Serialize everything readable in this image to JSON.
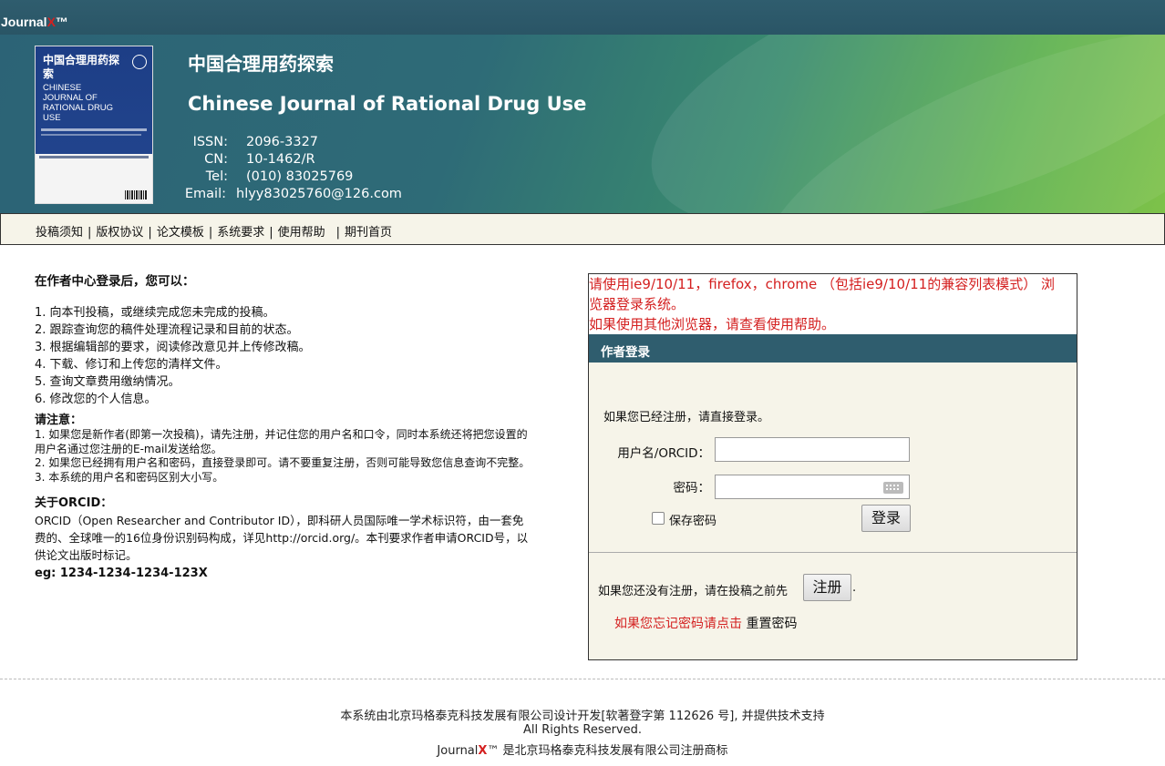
{
  "brand": {
    "prefix": "Journal",
    "x": "X",
    "tm": "™"
  },
  "journal": {
    "title_cn": "中国合理用药探索",
    "title_en": "Chinese Journal of Rational Drug Use",
    "cover": {
      "cn": "中国合理用药探索",
      "en": "CHINESE JOURNAL OF RATIONAL DRUG USE"
    },
    "info": [
      {
        "key": "ISSN:",
        "value": "2096-3327"
      },
      {
        "key": "CN:",
        "value": "10-1462/R"
      },
      {
        "key": "Tel:",
        "value": "(010) 83025769"
      },
      {
        "key": "Email:",
        "value": "hlyy83025760@126.com"
      }
    ]
  },
  "nav": [
    "投稿须知",
    "版权协议",
    "论文模板",
    "系统要求",
    "使用帮助",
    "期刊首页"
  ],
  "left": {
    "heading": "在作者中心登录后，您可以：",
    "items": [
      "1. 向本刊投稿，或继续完成您未完成的投稿。",
      "2. 跟踪查询您的稿件处理流程记录和目前的状态。",
      "3. 根据编辑部的要求，阅读修改意见并上传修改稿。",
      "4. 下载、修订和上传您的清样文件。",
      "5. 查询文章费用缴纳情况。",
      "6. 修改您的个人信息。"
    ],
    "note_title": "请注意：",
    "notes": [
      "1. 如果您是新作者(即第一次投稿)，请先注册，并记住您的用户名和口令，同时本系统还将把您设置的用户名通过您注册的E-mail发送给您。",
      "2. 如果您已经拥有用户名和密码，直接登录即可。请不要重复注册，否则可能导致您信息查询不完整。",
      "3. 本系统的用户名和密码区别大小写。"
    ],
    "orcid_title": "关于ORCID：",
    "orcid_text": "ORCID（Open Researcher and Contributor ID），即科研人员国际唯一学术标识符，由一套免费的、全球唯一的16位身份识别码构成，详见http://orcid.org/。本刊要求作者申请ORCID号，以供论文出版时标记。",
    "orcid_example": "eg: 1234-1234-1234-123X"
  },
  "login": {
    "warning1": "请使用ie9/10/11，firefox，chrome （包括ie9/10/11的兼容列表模式） 浏览器登录系统。",
    "warning2": "如果使用其他浏览器，请查看使用帮助。",
    "header": "作者登录",
    "intro": "如果您已经注册，请直接登录。",
    "username_label": "用户名/ORCID：",
    "username_value": "",
    "password_label": "密码：",
    "password_value": "",
    "remember_label": "保存密码",
    "login_button": "登录",
    "register_text": "如果您还没有注册，请在投稿之前先",
    "register_button": "注册",
    "register_dot": ".",
    "forgot_text": "如果您忘记密码请点击",
    "reset_link": "重置密码"
  },
  "footer": {
    "line1": "本系统由北京玛格泰克科技发展有限公司设计开发[软著登字第 112626 号], 并提供技术支持",
    "line2": "All Rights Reserved.",
    "line3_prefix": "Journal",
    "line3_x": "X",
    "line3_suffix": "™ 是北京玛格泰克科技发展有限公司注册商标"
  },
  "colors": {
    "header_teal": "#2f5d6e",
    "warning_red": "#d42020",
    "panel_bg": "#f6f4e9"
  }
}
